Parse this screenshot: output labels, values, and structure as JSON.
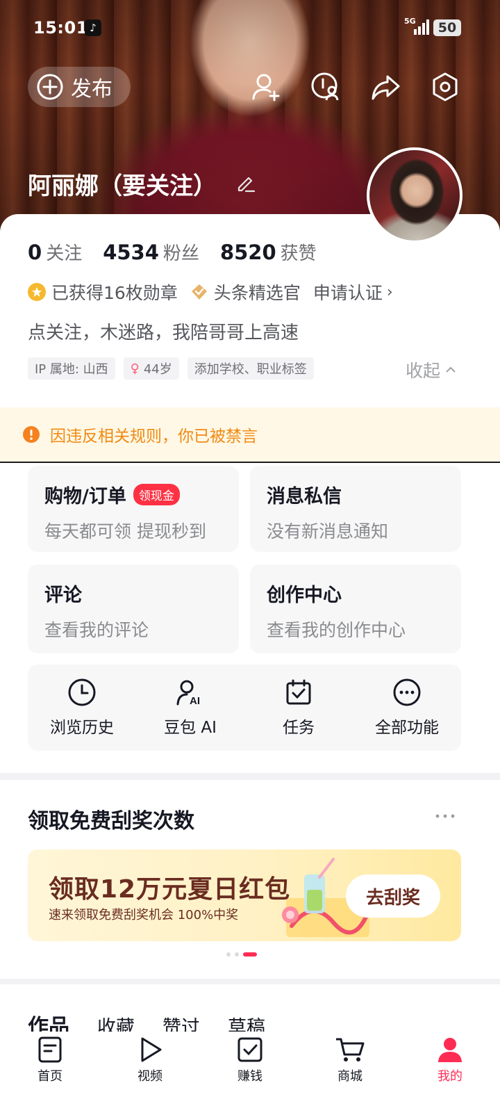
{
  "status_bar": {
    "time": "15:01",
    "network": "5G",
    "battery": "50"
  },
  "header": {
    "publish_label": "发布",
    "username": "阿丽娜（要关注）"
  },
  "stats": [
    {
      "value": "0",
      "label": "关注"
    },
    {
      "value": "4534",
      "label": "粉丝"
    },
    {
      "value": "8520",
      "label": "获赞"
    }
  ],
  "badges": {
    "medals": "已获得16枚勋章",
    "selector": "头条精选官",
    "verify": "申请认证"
  },
  "bio": "点关注，木迷路，我陪哥哥上高速",
  "tags": {
    "ip": "IP 属地: 山西",
    "age": "44岁",
    "add_label": "添加学校、职业标签"
  },
  "collapse_label": "收起",
  "ban_notice": "因违反相关规则，你已被禁言",
  "tiles": {
    "shop": {
      "title": "购物/订单",
      "badge": "领现金",
      "subtitle": "每天都可领 提现秒到"
    },
    "messages": {
      "title": "消息私信",
      "subtitle": "没有新消息通知"
    },
    "comments": {
      "title": "评论",
      "subtitle": "查看我的评论"
    },
    "creator": {
      "title": "创作中心",
      "subtitle": "查看我的创作中心"
    }
  },
  "tools": [
    {
      "label": "浏览历史",
      "icon": "clock-icon"
    },
    {
      "label": "豆包 AI",
      "icon": "ai-person-icon"
    },
    {
      "label": "任务",
      "icon": "calendar-check-icon"
    },
    {
      "label": "全部功能",
      "icon": "more-circle-icon"
    }
  ],
  "scratch_section": {
    "title": "领取免费刮奖次数",
    "promo_title": "领取12万元夏日红包",
    "promo_subtitle": "速来领取免费刮奖机会 100%中奖",
    "promo_button": "去刮奖",
    "carousel": {
      "count": 3,
      "active": 3
    }
  },
  "content_tabs": [
    "作品",
    "收藏",
    "赞过",
    "草稿"
  ],
  "bottom_nav": [
    {
      "label": "首页",
      "icon": "home-doc-icon"
    },
    {
      "label": "视频",
      "icon": "play-icon"
    },
    {
      "label": "赚钱",
      "icon": "check-box-icon"
    },
    {
      "label": "商城",
      "icon": "cart-icon"
    },
    {
      "label": "我的",
      "icon": "person-icon",
      "active": true
    }
  ],
  "colors": {
    "accent": "#fe2c55",
    "warning": "#f08a12",
    "promo_text": "#6a2c20"
  }
}
